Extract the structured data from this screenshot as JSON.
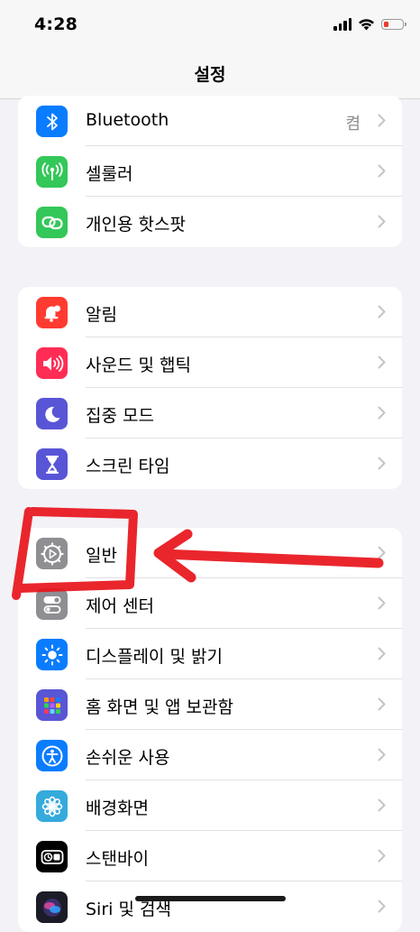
{
  "status_bar": {
    "time": "4:28"
  },
  "nav": {
    "title": "설정"
  },
  "groups": [
    {
      "items": [
        {
          "label": "Bluetooth",
          "value": "켬",
          "icon": "bluetooth-icon",
          "color": "#0a7cff"
        },
        {
          "label": "셀룰러",
          "icon": "antenna-icon",
          "color": "#34c759"
        },
        {
          "label": "개인용 핫스팟",
          "icon": "hotspot-link-icon",
          "color": "#34c759"
        }
      ]
    },
    {
      "items": [
        {
          "label": "알림",
          "icon": "bell-icon",
          "color": "#ff3b30"
        },
        {
          "label": "사운드 및 햅틱",
          "icon": "speaker-icon",
          "color": "#ff2d55"
        },
        {
          "label": "집중 모드",
          "icon": "moon-icon",
          "color": "#5856d6"
        },
        {
          "label": "스크린 타임",
          "icon": "hourglass-icon",
          "color": "#5856d6"
        }
      ]
    },
    {
      "items": [
        {
          "label": "일반",
          "icon": "gear-icon",
          "color": "#8e8e93"
        },
        {
          "label": "제어 센터",
          "icon": "toggles-icon",
          "color": "#8e8e93"
        },
        {
          "label": "디스플레이 및 밝기",
          "icon": "sun-icon",
          "color": "#0a7cff"
        },
        {
          "label": "홈 화면 및 앱 보관함",
          "icon": "app-grid-icon",
          "color": "#5856d6"
        },
        {
          "label": "손쉬운 사용",
          "icon": "accessibility-icon",
          "color": "#0a7cff"
        },
        {
          "label": "배경화면",
          "icon": "flower-icon",
          "color": "#35aadc"
        },
        {
          "label": "스탠바이",
          "icon": "standby-icon",
          "color": "#000000"
        },
        {
          "label": "Siri 및 검색",
          "icon": "siri-icon",
          "color": "#2a2a3a"
        }
      ]
    }
  ],
  "annotation": {
    "color": "#e8141b"
  }
}
